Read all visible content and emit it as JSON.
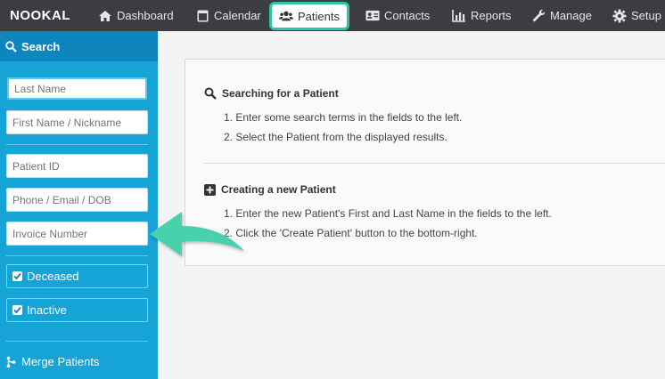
{
  "app": {
    "logo_text": "NOOKAL"
  },
  "nav": {
    "items": [
      {
        "label": "Dashboard",
        "icon": "home-icon"
      },
      {
        "label": "Calendar",
        "icon": "calendar-icon"
      },
      {
        "label": "Patients",
        "icon": "users-icon",
        "active": true
      },
      {
        "label": "Contacts",
        "icon": "address-card-icon"
      },
      {
        "label": "Reports",
        "icon": "bar-chart-icon"
      },
      {
        "label": "Manage",
        "icon": "wrench-icon"
      },
      {
        "label": "Setup",
        "icon": "gear-icon"
      }
    ]
  },
  "sidebar": {
    "header": "Search",
    "fields": {
      "last_name": "Last Name",
      "first_name": "First Name / Nickname",
      "patient_id": "Patient ID",
      "phone_email_dob": "Phone / Email / DOB",
      "invoice_number": "Invoice Number"
    },
    "checks": {
      "deceased": {
        "label": "Deceased",
        "checked": true
      },
      "inactive": {
        "label": "Inactive",
        "checked": true
      }
    },
    "merge_label": "Merge Patients"
  },
  "main": {
    "search_section": {
      "title": "Searching for a Patient",
      "steps": [
        "1.  Enter some search terms in the fields to the left.",
        "2.  Select the Patient from the displayed results."
      ]
    },
    "create_section": {
      "title": "Creating a new Patient",
      "steps": [
        "1.  Enter the new Patient's First and Last Name in the fields to the left.",
        "2.  Click the 'Create Patient' button to the bottom-right."
      ]
    }
  },
  "colors": {
    "topnav": "#3b3d40",
    "sidebar": "#16a4d6",
    "sidebar_header": "#0e85bd",
    "highlight": "#2ec4a6"
  }
}
